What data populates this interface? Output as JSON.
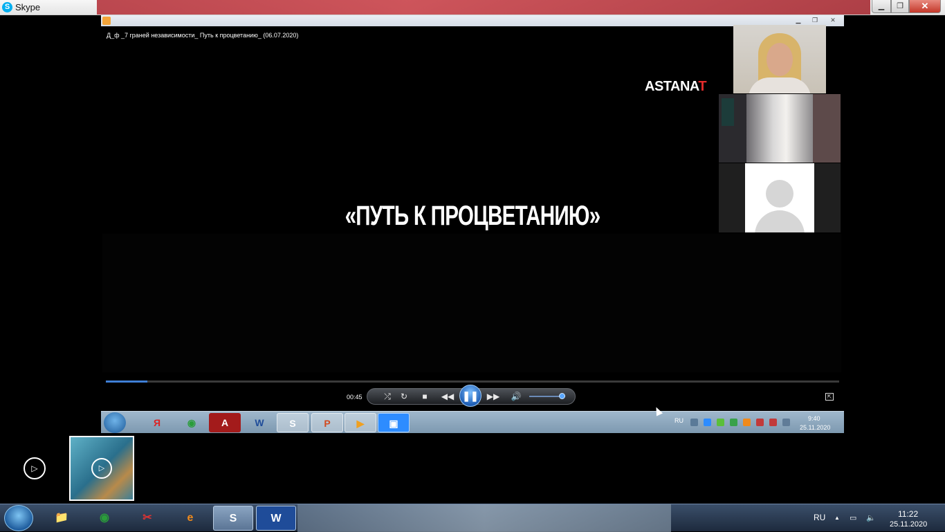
{
  "skype_window": {
    "title": "Skype",
    "icons": {
      "app": "skype-icon",
      "minimize": "minimize-icon",
      "restore": "restore-icon",
      "close": "close-icon"
    },
    "labels": {
      "logo": "S",
      "minimize": "▁",
      "restore": "❐",
      "close": "✕"
    }
  },
  "shared_screen": {
    "player": {
      "video_title": "Д_ф _7 граней независимости_ Путь к процветанию_ (06.07.2020)",
      "window_buttons": {
        "minimize": "▁",
        "restore": "❐",
        "close": "✕"
      },
      "channel_logo": {
        "main": "ASTANA",
        "accent": "T"
      },
      "caption": "«ПУТЬ К ПРОЦВЕТАНИЮ»",
      "elapsed": "00:45",
      "progress_fraction": 0.057,
      "volume_fraction": 0.9,
      "accent_color": "#3f7fd6",
      "controls": {
        "shuffle": "⤮",
        "repeat": "↻",
        "stop": "■",
        "prev": "◀◀",
        "play_pause": "❚❚",
        "next": "▶▶",
        "mute": "🔊",
        "switch_view": "⇱"
      }
    },
    "participants": [
      {
        "name": "participant-woman",
        "type": "video"
      },
      {
        "name": "participant-room",
        "type": "video"
      },
      {
        "name": "participant-no-camera",
        "type": "avatar-placeholder"
      }
    ],
    "taskbar": {
      "apps": [
        "Я",
        "◉",
        "A",
        "W",
        "S",
        "P",
        "▶",
        "▣"
      ],
      "lang": "RU",
      "time": "9:40",
      "date": "25.11.2020"
    }
  },
  "local": {
    "play_button": "▷",
    "thumbnail_play": "▷",
    "taskbar": {
      "apps": [
        "📁",
        "◉",
        "✂",
        "e",
        "S",
        "W"
      ],
      "lang": "RU",
      "time": "11:22",
      "date": "25.11.2020",
      "tray": {
        "arrow": "▲",
        "network": "▭",
        "volume": "🔈"
      }
    }
  }
}
